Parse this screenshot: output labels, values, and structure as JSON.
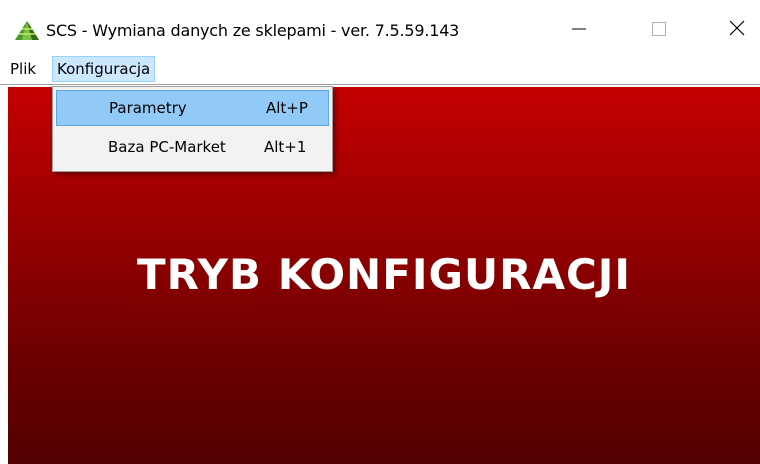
{
  "window": {
    "title": "SCS - Wymiana danych ze sklepami  -  ver. 7.5.59.143",
    "app_icon": "green-pyramid-icon",
    "controls": {
      "minimize_glyph": "—",
      "maximize_glyph": "☐",
      "close_glyph": "✕"
    }
  },
  "menubar": {
    "items": [
      {
        "label": "Plik"
      },
      {
        "label": "Konfiguracja",
        "active": true
      }
    ]
  },
  "dropdown": {
    "items": [
      {
        "label": "Parametry",
        "shortcut": "Alt+P",
        "highlighted": true
      },
      {
        "label": "Baza PC-Market",
        "shortcut": "Alt+1",
        "highlighted": false
      }
    ]
  },
  "content": {
    "mode_label": "TRYB KONFIGURACJI",
    "background_top": "#c40000",
    "background_bottom": "#520000"
  },
  "colors": {
    "menu_active_bg": "#cce8ff",
    "menu_highlight_bg": "#91c9f7",
    "dropdown_bg": "#f2f2f2"
  }
}
